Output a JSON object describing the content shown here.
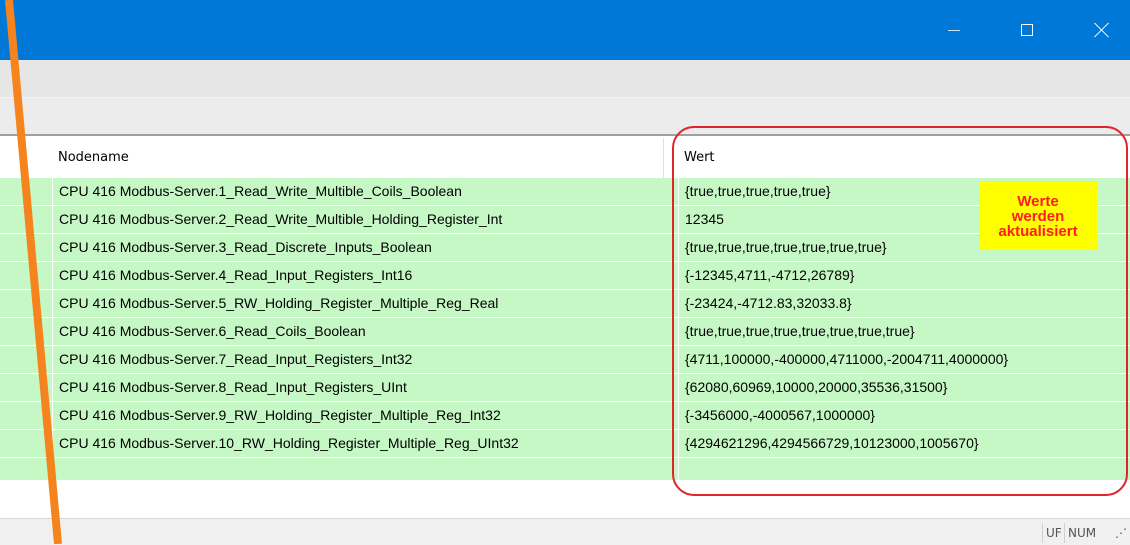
{
  "window": {
    "minimize_symbol": "—",
    "maximize_symbol": "☐",
    "close_symbol": "✕"
  },
  "table": {
    "columns": [
      "Nodename",
      "Wert"
    ],
    "rows": [
      {
        "node": "CPU 416 Modbus-Server.1_Read_Write_Multible_Coils_Boolean",
        "wert": "{true,true,true,true,true}"
      },
      {
        "node": "CPU 416 Modbus-Server.2_Read_Write_Multible_Holding_Register_Int",
        "wert": "12345"
      },
      {
        "node": "CPU 416 Modbus-Server.3_Read_Discrete_Inputs_Boolean",
        "wert": "{true,true,true,true,true,true,true}"
      },
      {
        "node": "CPU 416 Modbus-Server.4_Read_Input_Registers_Int16",
        "wert": "{-12345,4711,-4712,26789}"
      },
      {
        "node": "CPU 416 Modbus-Server.5_RW_Holding_Register_Multiple_Reg_Real",
        "wert": "{-23424,-4712.83,32033.8}"
      },
      {
        "node": "CPU 416 Modbus-Server.6_Read_Coils_Boolean",
        "wert": "{true,true,true,true,true,true,true,true}"
      },
      {
        "node": "CPU 416 Modbus-Server.7_Read_Input_Registers_Int32",
        "wert": "{4711,100000,-400000,4711000,-2004711,4000000}"
      },
      {
        "node": "CPU 416 Modbus-Server.8_Read_Input_Registers_UInt",
        "wert": "{62080,60969,10000,20000,35536,31500}"
      },
      {
        "node": "CPU 416 Modbus-Server.9_RW_Holding_Register_Multiple_Reg_Int32",
        "wert": "{-3456000,-4000567,1000000}"
      },
      {
        "node": "CPU 416 Modbus-Server.10_RW_Holding_Register_Multiple_Reg_UInt32",
        "wert": "{4294621296,4294566729,10123000,1005670}"
      }
    ]
  },
  "annotation": {
    "note_lines": [
      "Werte",
      "werden",
      "aktualisiert"
    ],
    "highlight_color": "#e0242c",
    "note_background": "#ffff00",
    "note_text_color": "#ff1e1e"
  },
  "statusbar": {
    "uf": "UF",
    "num": "NUM",
    "grip": "⋰"
  },
  "colors": {
    "titlebar": "#0078d7",
    "row_background": "#c6f8c6",
    "orange_line": "#f5841f"
  }
}
